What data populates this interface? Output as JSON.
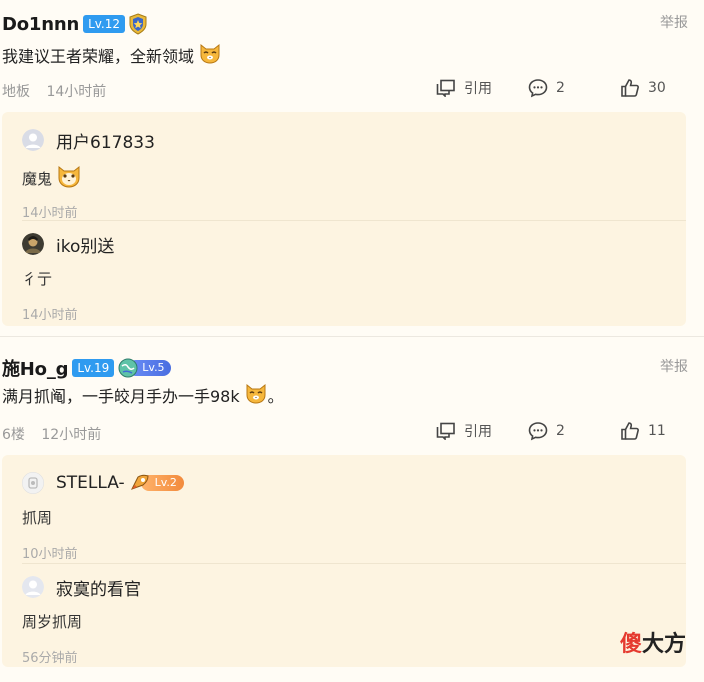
{
  "posts": [
    {
      "username": "Do1nnn",
      "level": "Lv.12",
      "report": "举报",
      "content": "我建议王者荣耀，全新领域",
      "floor": "地板",
      "time": "14小时前",
      "quote_label": "引用",
      "comments": "2",
      "likes": "30",
      "replies": [
        {
          "name": "用户617833",
          "text": "魔鬼",
          "time": "14小时前"
        },
        {
          "name": "iko别送",
          "text": "彳亍",
          "time": "14小时前"
        }
      ]
    },
    {
      "username": "施Ho_g",
      "level": "Lv.19",
      "extra_level": "Lv.5",
      "report": "举报",
      "content_before": "满月抓阄，一手皎月手办一手98k",
      "content_after": "。",
      "floor": "6楼",
      "time": "12小时前",
      "quote_label": "引用",
      "comments": "2",
      "likes": "11",
      "replies": [
        {
          "name": "STELLA-",
          "level": "Lv.2",
          "text": "抓周",
          "time": "10小时前"
        },
        {
          "name": "寂寞的看官",
          "text": "周岁抓周",
          "time": "56分钟前"
        }
      ]
    }
  ],
  "watermark": {
    "red": "傻",
    "rest": "大方"
  },
  "icons": {
    "quote": "quote-icon",
    "comment": "comment-icon",
    "like": "thumbs-up-icon",
    "emoji": "cat-face-emoji-icon",
    "shield": "shield-badge-icon"
  },
  "colors": {
    "level_blue": "#2f9bf0",
    "reply_bg": "#fdf4e1",
    "page_bg": "#fffcf5"
  }
}
